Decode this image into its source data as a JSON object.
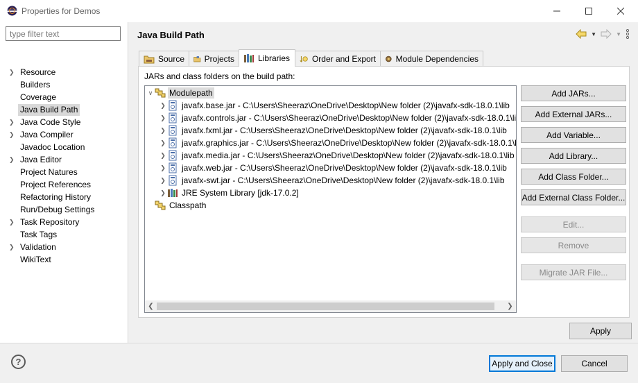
{
  "window": {
    "title": "Properties for Demos",
    "icons": {
      "app": "eclipse-icon",
      "minimize": "minimize-icon",
      "maximize": "maximize-icon",
      "close": "close-icon"
    }
  },
  "sidebar": {
    "filter_placeholder": "type filter text",
    "items": [
      {
        "label": "Resource",
        "expandable": true
      },
      {
        "label": "Builders",
        "expandable": false
      },
      {
        "label": "Coverage",
        "expandable": false
      },
      {
        "label": "Java Build Path",
        "expandable": false,
        "selected": true
      },
      {
        "label": "Java Code Style",
        "expandable": true
      },
      {
        "label": "Java Compiler",
        "expandable": true
      },
      {
        "label": "Javadoc Location",
        "expandable": false
      },
      {
        "label": "Java Editor",
        "expandable": true
      },
      {
        "label": "Project Natures",
        "expandable": false
      },
      {
        "label": "Project References",
        "expandable": false
      },
      {
        "label": "Refactoring History",
        "expandable": false
      },
      {
        "label": "Run/Debug Settings",
        "expandable": false
      },
      {
        "label": "Task Repository",
        "expandable": true
      },
      {
        "label": "Task Tags",
        "expandable": false
      },
      {
        "label": "Validation",
        "expandable": true
      },
      {
        "label": "WikiText",
        "expandable": false
      }
    ]
  },
  "main": {
    "title": "Java Build Path",
    "toolbar_icons": [
      "back-arrow-icon",
      "dropdown-icon",
      "forward-arrow-icon",
      "dropdown-icon",
      "more-icon"
    ],
    "tabs": [
      {
        "label": "Source",
        "icon": "source-folder-icon"
      },
      {
        "label": "Projects",
        "icon": "projects-icon"
      },
      {
        "label": "Libraries",
        "icon": "libraries-icon",
        "active": true
      },
      {
        "label": "Order and Export",
        "icon": "order-export-icon"
      },
      {
        "label": "Module Dependencies",
        "icon": "module-dependencies-icon"
      }
    ],
    "panel_label": "JARs and class folders on the build path:",
    "tree": {
      "modulepath": "Modulepath",
      "jars": [
        "javafx.base.jar - C:\\Users\\Sheeraz\\OneDrive\\Desktop\\New folder (2)\\javafx-sdk-18.0.1\\lib",
        "javafx.controls.jar - C:\\Users\\Sheeraz\\OneDrive\\Desktop\\New folder (2)\\javafx-sdk-18.0.1\\li",
        "javafx.fxml.jar - C:\\Users\\Sheeraz\\OneDrive\\Desktop\\New folder (2)\\javafx-sdk-18.0.1\\lib",
        "javafx.graphics.jar - C:\\Users\\Sheeraz\\OneDrive\\Desktop\\New folder (2)\\javafx-sdk-18.0.1\\l",
        "javafx.media.jar - C:\\Users\\Sheeraz\\OneDrive\\Desktop\\New folder (2)\\javafx-sdk-18.0.1\\lib",
        "javafx.web.jar - C:\\Users\\Sheeraz\\OneDrive\\Desktop\\New folder (2)\\javafx-sdk-18.0.1\\lib",
        "javafx-swt.jar - C:\\Users\\Sheeraz\\OneDrive\\Desktop\\New folder (2)\\javafx-sdk-18.0.1\\lib"
      ],
      "jre": "JRE System Library [jdk-17.0.2]",
      "classpath": "Classpath"
    },
    "buttons": {
      "add_jars": "Add JARs...",
      "add_external_jars": "Add External JARs...",
      "add_variable": "Add Variable...",
      "add_library": "Add Library...",
      "add_class_folder": "Add Class Folder...",
      "add_external_class_folder": "Add External Class Folder...",
      "edit": "Edit...",
      "remove": "Remove",
      "migrate_jar": "Migrate JAR File..."
    },
    "apply": "Apply"
  },
  "footer": {
    "apply_and_close": "Apply and Close",
    "cancel": "Cancel"
  }
}
